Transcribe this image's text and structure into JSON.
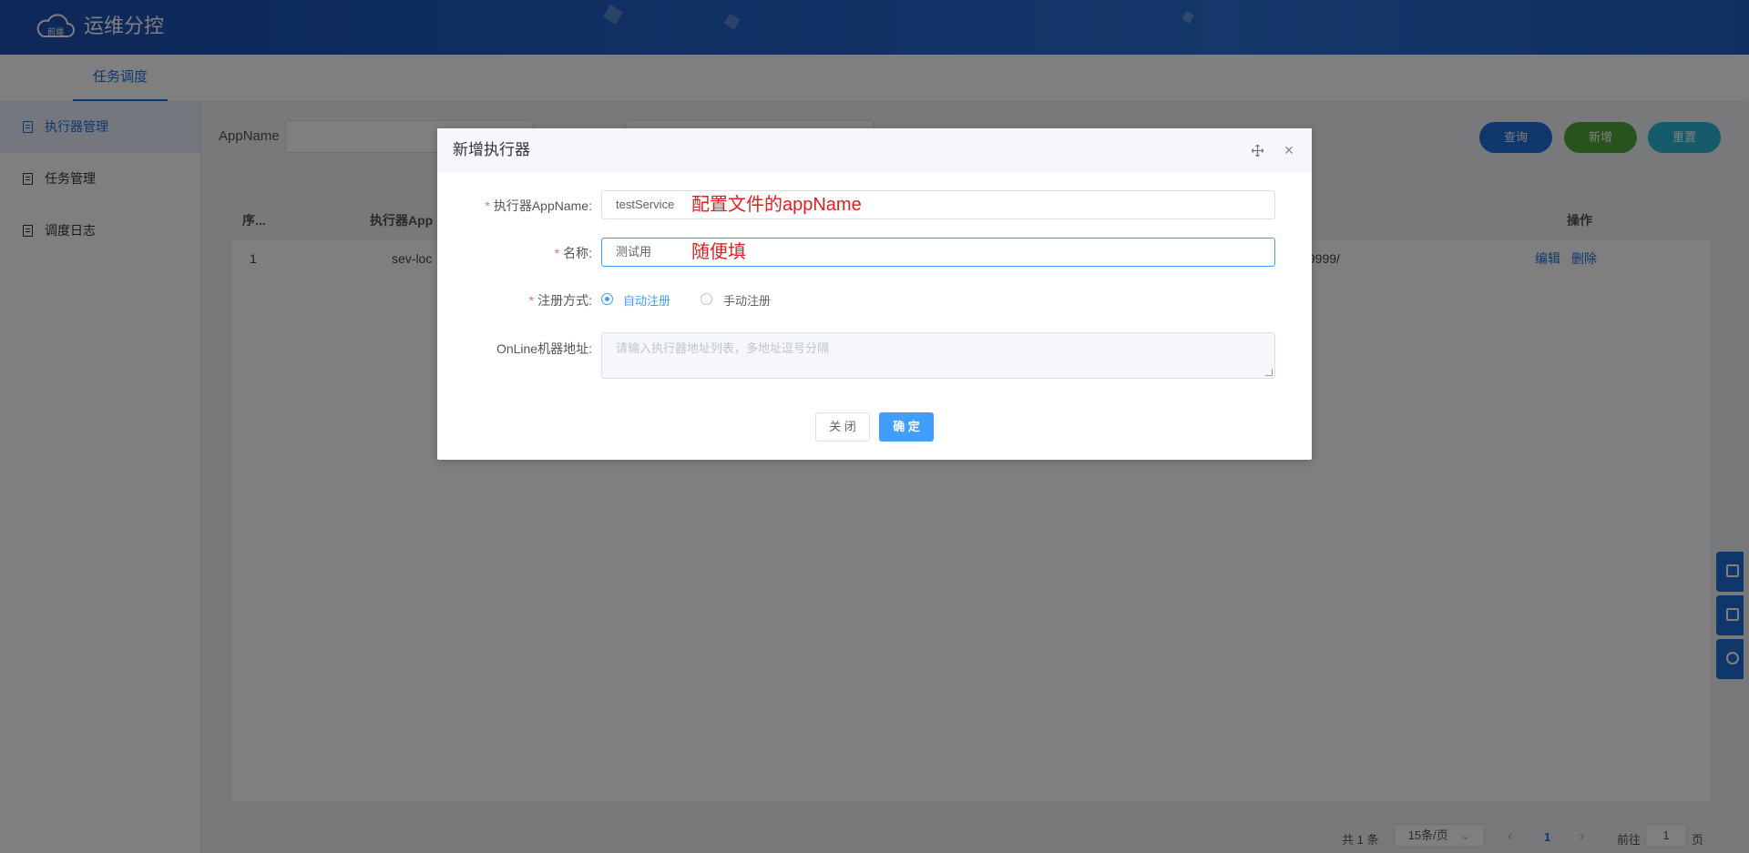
{
  "header": {
    "brand": "运维分控",
    "logo_text": "前端"
  },
  "tabs": [
    {
      "label": "任务调度"
    }
  ],
  "sidebar": {
    "items": [
      {
        "label": "执行器管理",
        "icon": "document-icon",
        "active": true
      },
      {
        "label": "任务管理",
        "icon": "document-icon"
      },
      {
        "label": "调度日志",
        "icon": "document-icon"
      }
    ]
  },
  "filter": {
    "appname_label": "AppName",
    "buttons": {
      "query": "查询",
      "add": "新增",
      "reset": "重置"
    }
  },
  "table": {
    "headers": {
      "index": "序...",
      "appname": "执行器App",
      "ops": "操作"
    },
    "rows": [
      {
        "index": "1",
        "appname": "sev-loc",
        "address": ":9999/",
        "edit": "编辑",
        "delete": "删除"
      }
    ]
  },
  "pagination": {
    "total": "共 1 条",
    "page_size": "15条/页",
    "current_page": "1",
    "goto_label": "前往",
    "goto_value": "1",
    "page_suffix": "页"
  },
  "dialog": {
    "title": "新增执行器",
    "fields": {
      "appname": {
        "label": "执行器AppName:",
        "value": "testService",
        "annotation": "配置文件的appName"
      },
      "name": {
        "label": "名称:",
        "value": "测试用",
        "annotation": "随便填"
      },
      "register": {
        "label": "注册方式:",
        "options": [
          "自动注册",
          "手动注册"
        ],
        "selected": "自动注册"
      },
      "online": {
        "label": "OnLine机器地址:",
        "placeholder": "请输入执行器地址列表，多地址逗号分隔"
      }
    },
    "buttons": {
      "close": "关 闭",
      "confirm": "确 定"
    }
  },
  "colors": {
    "primary": "#1e6fd9",
    "element_blue": "#409eff",
    "add_green": "#52a639",
    "reset_cyan": "#2bb7d8",
    "annotation_red": "#e02020"
  }
}
